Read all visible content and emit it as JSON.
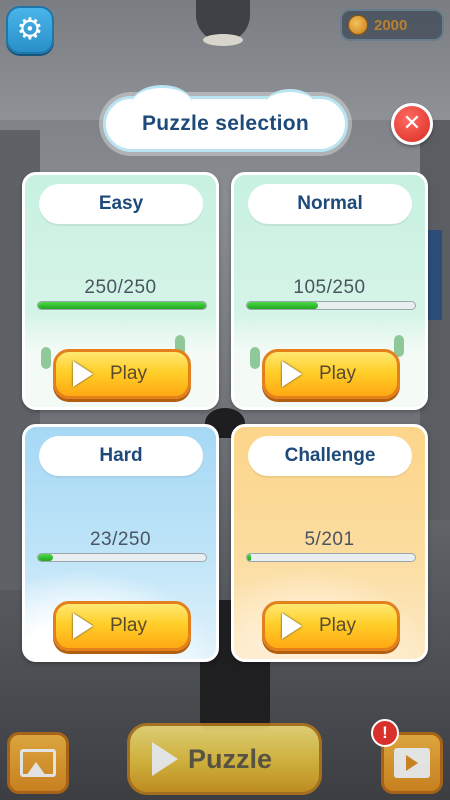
{
  "header": {
    "coins": "2000",
    "title": "Puzzle selection",
    "settings_icon": "gear-icon",
    "close_icon": "close-icon"
  },
  "levels": [
    {
      "name": "Easy",
      "progress_text": "250/250",
      "completed": 250,
      "total": 250,
      "progress": 1.0,
      "play_label": "Play"
    },
    {
      "name": "Normal",
      "progress_text": "105/250",
      "completed": 105,
      "total": 250,
      "progress": 0.42,
      "play_label": "Play"
    },
    {
      "name": "Hard",
      "progress_text": "23/250",
      "completed": 23,
      "total": 250,
      "progress": 0.092,
      "play_label": "Play"
    },
    {
      "name": "Challenge",
      "progress_text": "5/201",
      "completed": 5,
      "total": 201,
      "progress": 0.025,
      "play_label": "Play"
    }
  ],
  "bottom_bar": {
    "puzzle_label": "Puzzle",
    "alert_badge": "!",
    "gallery_icon": "image-icon",
    "video_icon": "video-icon"
  },
  "colors": {
    "accent_blue": "#2a8fc9",
    "title_text": "#1e4a7a",
    "progress_green": "#21a81f",
    "play_orange": "#ffcf2a",
    "close_red": "#d82b22",
    "easy_bg": "#c8f1e0",
    "hard_bg": "#a6d8f5",
    "challenge_bg": "#fcd589"
  }
}
